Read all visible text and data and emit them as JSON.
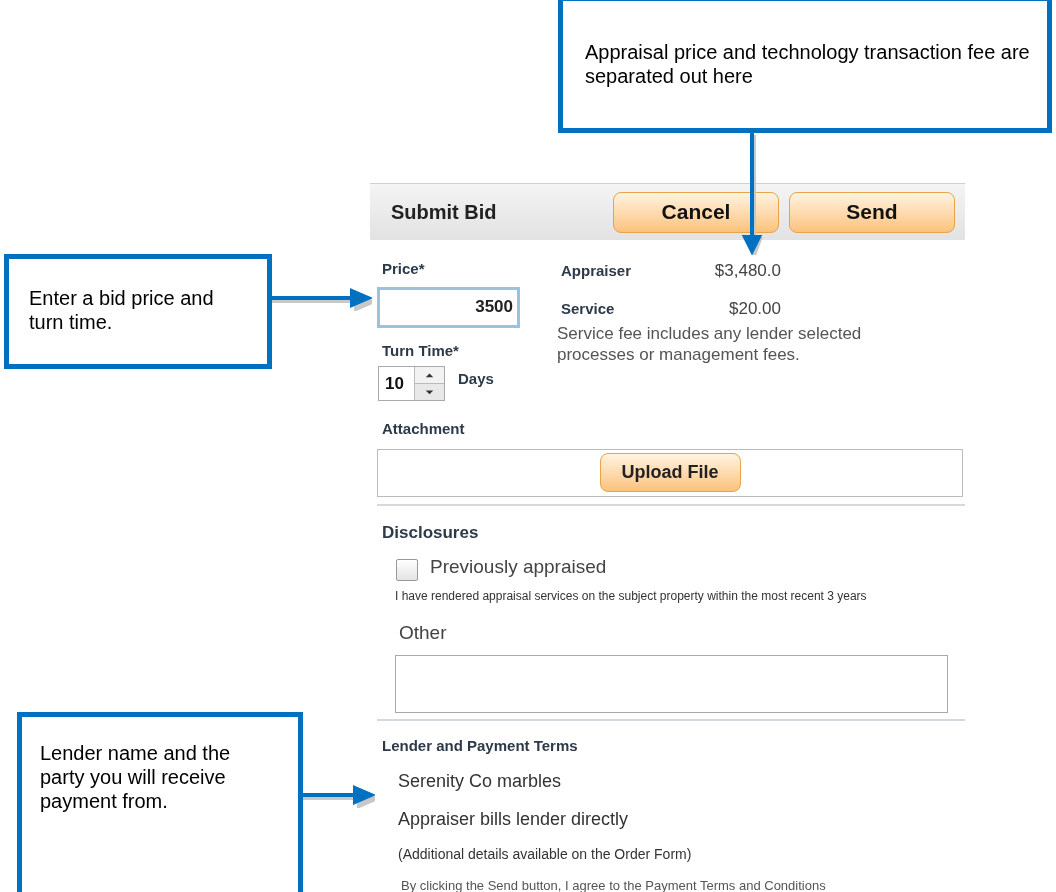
{
  "callouts": [
    {
      "text": "Appraisal price and technology transaction fee are separated out here"
    },
    {
      "text": "Enter a bid price and turn time."
    },
    {
      "text": "Lender name and the party you will receive payment from."
    }
  ],
  "header": {
    "title": "Submit Bid",
    "buttons": [
      "Cancel",
      "Send"
    ]
  },
  "price": {
    "label": "Price*",
    "value": "3500"
  },
  "fees": [
    {
      "label": "Appraiser",
      "amount": "$3,480.0"
    },
    {
      "label": "Service",
      "amount": "$20.00"
    }
  ],
  "fee_note": "Service fee includes any lender selected processes or management fees.",
  "turn_time": {
    "label": "Turn Time*",
    "value": "10",
    "unit": "Days"
  },
  "attachment": {
    "label": "Attachment",
    "button": "Upload File"
  },
  "disclosures": {
    "heading": "Disclosures",
    "checkbox": {
      "label": "Previously appraised",
      "checked": false
    },
    "description": "I have rendered appraisal services on the subject property within the most recent 3 years",
    "other_label": "Other"
  },
  "lender": {
    "heading": "Lender and Payment Terms",
    "name": "Serenity Co marbles",
    "billing": "Appraiser bills lender directly",
    "details": "(Additional details available on the Order Form)",
    "agreement": "By clicking the Send button, I agree to the Payment Terms and Conditions"
  }
}
